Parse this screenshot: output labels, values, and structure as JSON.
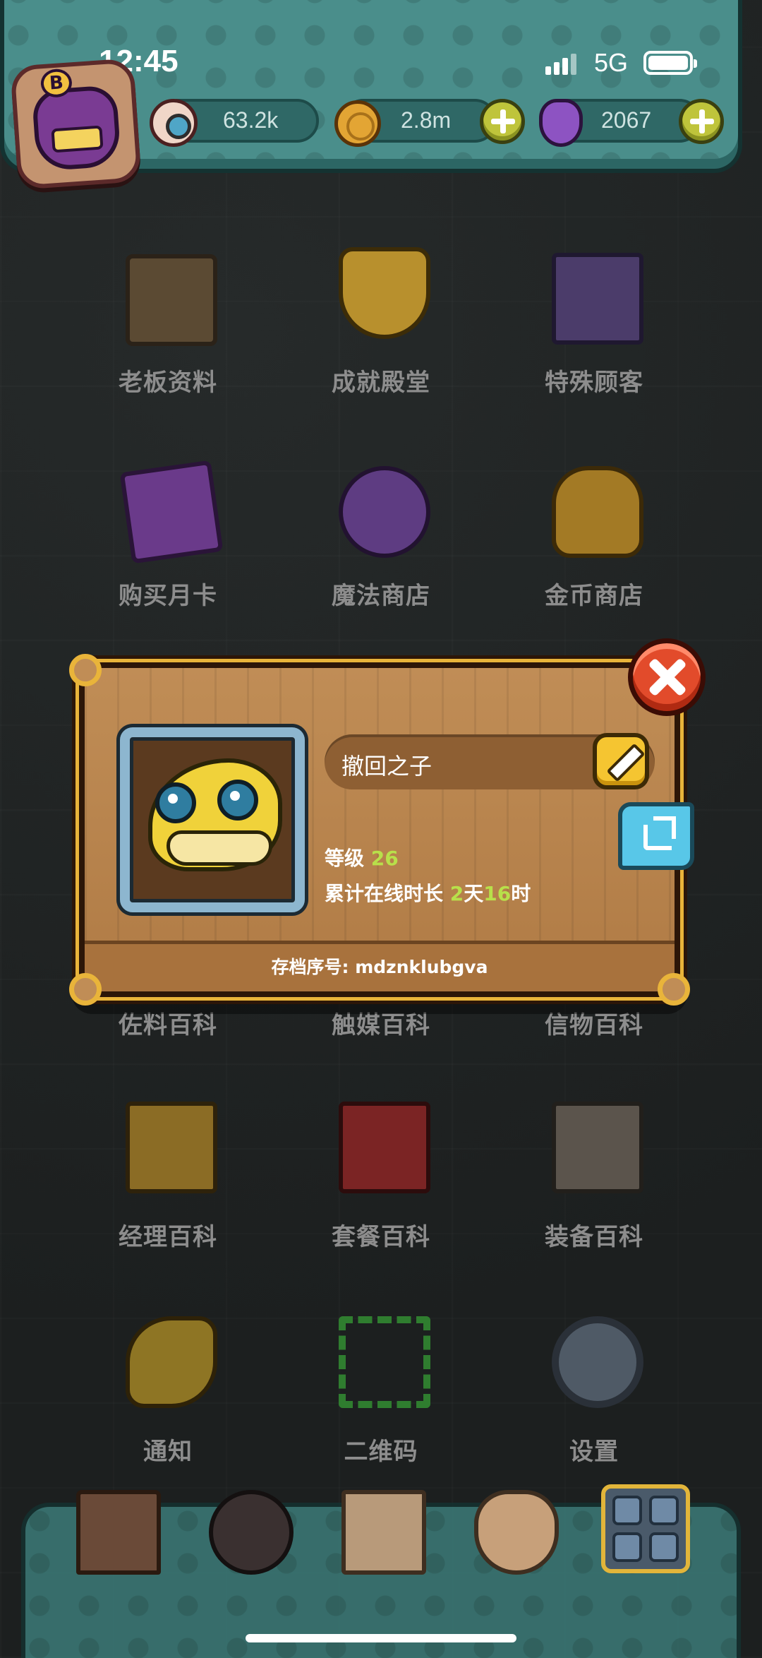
{
  "status_bar": {
    "time": "12:45",
    "network": "5G"
  },
  "currencies": [
    {
      "icon": "eyeball-icon",
      "value": "63.2k"
    },
    {
      "icon": "gold-coin-icon",
      "value": "2.8m"
    },
    {
      "icon": "potion-icon",
      "value": "2067"
    }
  ],
  "menu": {
    "row1": [
      "老板资料",
      "成就殿堂",
      "特殊顾客"
    ],
    "row2": [
      "购买月卡",
      "魔法商店",
      "金币商店"
    ],
    "row4": [
      "佐料百科",
      "触媒百科",
      "信物百科"
    ],
    "row5": [
      "经理百科",
      "套餐百科",
      "装备百科"
    ],
    "row6": [
      "通知",
      "二维码",
      "设置"
    ]
  },
  "profile_dialog": {
    "player_name": "撤回之子",
    "level_label": "等级",
    "level_value": "26",
    "online_label": "累计在线时长",
    "online_days_value": "2",
    "online_days_unit": "天",
    "online_hours_value": "16",
    "online_hours_unit": "时",
    "save_id": "存档序号: mdznklubgva"
  },
  "colors": {
    "teal_panel": "#4a8e8b",
    "dialog_wood": "#b8854e",
    "gold_trim": "#e9b43a",
    "highlight_green": "#b8e04a",
    "close_red": "#e24b2b"
  }
}
